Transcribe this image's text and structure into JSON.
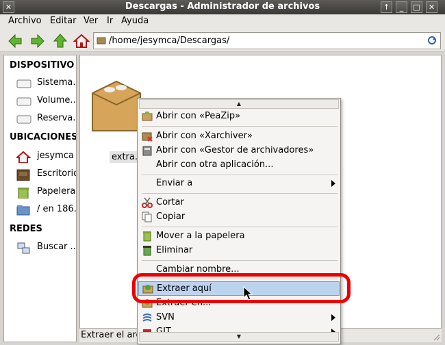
{
  "window": {
    "title": "Descargas - Administrador de archivos"
  },
  "menubar": [
    {
      "label": "Archivo"
    },
    {
      "label": "Editar"
    },
    {
      "label": "Ver"
    },
    {
      "label": "Ir"
    },
    {
      "label": "Ayuda"
    }
  ],
  "toolbar": {
    "path": "/home/jesymca/Descargas/"
  },
  "sidebar": {
    "devices_header": "DISPOSITIVO",
    "devices": [
      {
        "label": "Sistema..."
      },
      {
        "label": "Volume..."
      },
      {
        "label": "Reserva..."
      }
    ],
    "places_header": "UBICACIONES",
    "places": [
      {
        "label": "jesymca"
      },
      {
        "label": "Escritorio"
      },
      {
        "label": "Papelera"
      },
      {
        "label": "/ en 186."
      }
    ],
    "network_header": "REDES",
    "network": [
      {
        "label": "Buscar ..."
      }
    ]
  },
  "main": {
    "file_label": "extra."
  },
  "status": {
    "text": "Extraer el arc"
  },
  "context_menu": {
    "items": [
      {
        "label": "Abrir con «PeaZip»",
        "icon": "peazip-icon"
      },
      {
        "label": "Abrir con «Xarchiver»",
        "icon": "xarchiver-icon"
      },
      {
        "label": "Abrir con «Gestor de archivadores»",
        "icon": "archive-manager-icon"
      },
      {
        "label": "Abrir con otra aplicación..."
      },
      {
        "label": "Enviar a"
      },
      {
        "label": "Cortar",
        "icon": "scissors-icon"
      },
      {
        "label": "Copiar",
        "icon": "copy-icon"
      },
      {
        "label": "Mover a la papelera",
        "icon": "trash-icon"
      },
      {
        "label": "Eliminar",
        "icon": "delete-icon"
      },
      {
        "label": "Cambiar nombre..."
      },
      {
        "label": "Extraer aquí",
        "icon": "extract-icon",
        "highlighted": true
      },
      {
        "label": "Extraer en..."
      },
      {
        "label": "SVN",
        "icon": "svn-icon"
      },
      {
        "label": "GIT",
        "icon": "git-icon"
      }
    ]
  },
  "colors": {
    "highlight": "#bcd3ef",
    "annotation": "#ee0000",
    "titlebar": "#4a4846"
  }
}
